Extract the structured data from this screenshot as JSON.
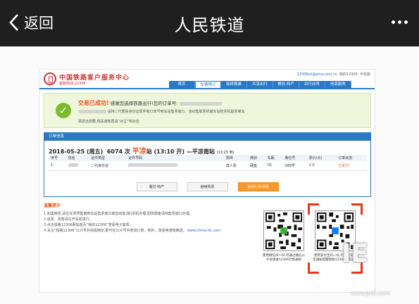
{
  "topbar": {
    "back_label": "返回",
    "title": "人民铁道",
    "more_icon": "more-dots-icon"
  },
  "site": {
    "brand": "中国铁路客户服务中心",
    "hotline": "客服热线:12306",
    "util_email": "12306yh@sina.com.cn",
    "util_text": "我的12306",
    "util_mobile": "手机版",
    "nav": [
      "首页",
      "车票预订",
      "接续换乘",
      "共享出行",
      "餐饮·特产",
      "出行向导",
      "信息服务"
    ],
    "nav_active": 1
  },
  "success": {
    "title_ok": "交易已成功!",
    "title_rest": "感谢您选择铁路出行!您的订单号:",
    "line2": "请持二代居民身份证原件和订单号到车站售票窗口、自动售取票机或车站检票机取票乘车",
    "line3": "猜您还想要,相关通知再说“对立”吧对应"
  },
  "order": {
    "section_title": "订单信息",
    "date": "2018-05-25",
    "weekday": "(周五)",
    "train": "6074",
    "dep_station": "平凉",
    "dep_time": "(13:10 开)",
    "arr_station": "—平凉南",
    "arr_time": "(13:25 到)",
    "columns": [
      "序号",
      "姓名",
      "证件类型",
      "证件号码",
      "票种",
      "席别",
      "车厢",
      "席位号",
      "票价(元)",
      "订单状态"
    ],
    "rows": [
      [
        "1",
        "",
        "二代身份证",
        "",
        "成人票",
        "硬座",
        "01",
        "089号",
        "1.0",
        "已支付"
      ]
    ],
    "buttons": [
      "餐饮·特产",
      "继续购票",
      "查询订单详情"
    ]
  },
  "tips": {
    "title": "温馨提示",
    "lines": [
      "1.如需换票,请在车票预售期到车站售票窗口或自动售(取)票机办理,团体旅客请到售票窗口办理。",
      "2.退票、改签请在开车前进行。",
      "3.点击铁路12306网站首页“我的12306”查看电子客票。",
      "4.关注“铁路12306”公众号并完成绑定,即可在公众号中查询订单、候补、改签等通知推送。",
      "www.china-tlc.com"
    ],
    "qr1_caption": "使用微信扫一扫,可通过微信公众号接收12306行程通知",
    "qr2_caption": "使用支付宝扫一扫,可通过支付宝通知提醒接收12306行程通知"
  },
  "watermark": {
    "mark": "IE",
    "url": "www.pc6.com"
  }
}
